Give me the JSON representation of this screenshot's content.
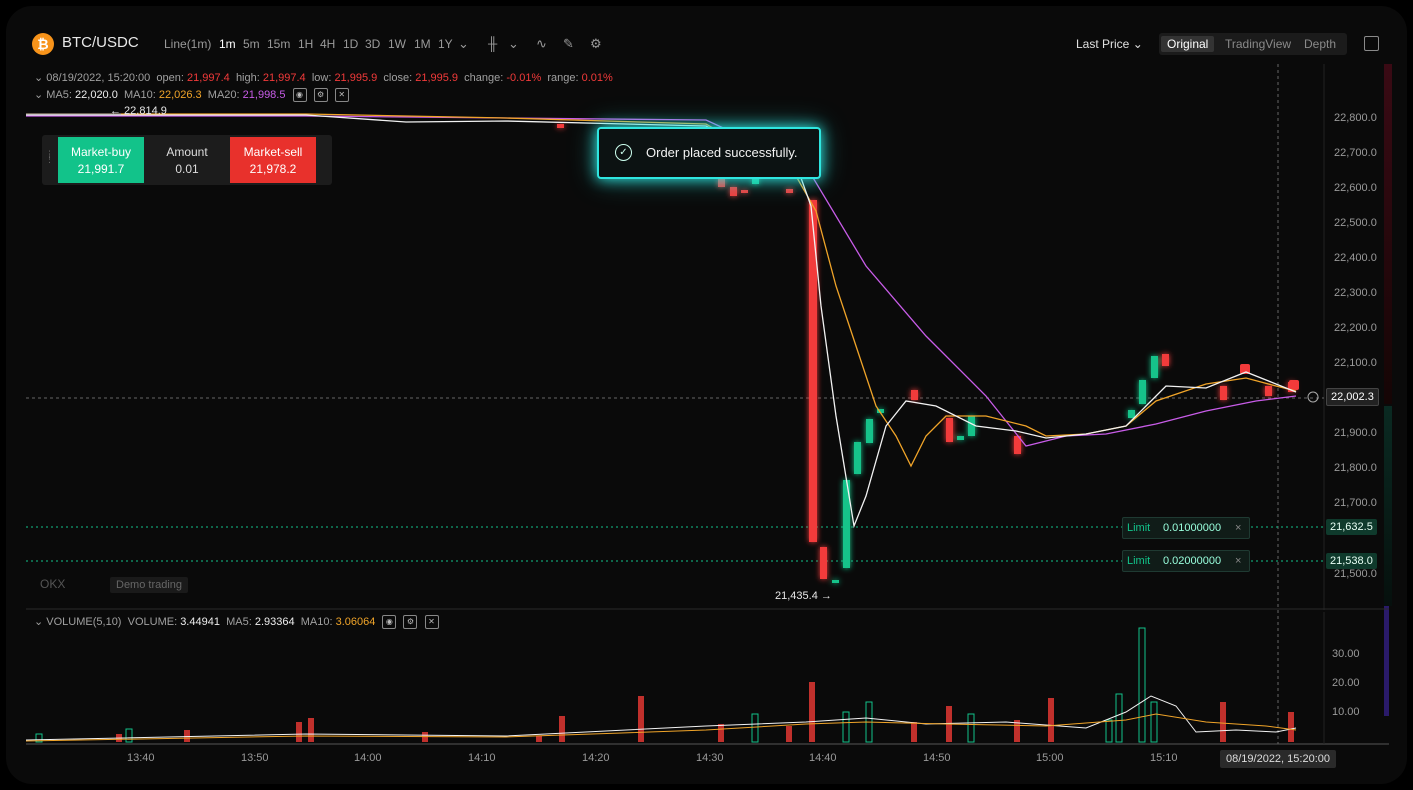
{
  "header": {
    "pair": "BTC/USDC",
    "coin_symbol": "₿",
    "chart_type": "Line(1m)",
    "timeframes": [
      "1m",
      "5m",
      "15m",
      "1H",
      "4H",
      "1D",
      "3D",
      "1W",
      "1M",
      "1Y"
    ],
    "active_timeframe": "1m",
    "last_price_label": "Last Price",
    "views": [
      "Original",
      "TradingView",
      "Depth"
    ],
    "active_view": "Original"
  },
  "ohlc": {
    "date": "08/19/2022, 15:20:00",
    "open_label": "open:",
    "open": "21,997.4",
    "high_label": "high:",
    "high": "21,997.4",
    "low_label": "low:",
    "low": "21,995.9",
    "close_label": "close:",
    "close": "21,995.9",
    "change_label": "change:",
    "change": "-0.01%",
    "range_label": "range:",
    "range": "0.01%"
  },
  "ma": {
    "ma5_label": "MA5:",
    "ma5": "22,020.0",
    "ma10_label": "MA10:",
    "ma10": "22,026.3",
    "ma20_label": "MA20:",
    "ma20": "21,998.5"
  },
  "trade_panel": {
    "buy_label": "Market-buy",
    "buy_price": "21,991.7",
    "amount_label": "Amount",
    "amount": "0.01",
    "sell_label": "Market-sell",
    "sell_price": "21,978.2"
  },
  "toast": {
    "message": "Order placed successfully."
  },
  "price_axis": [
    "22,800.0",
    "22,700.0",
    "22,600.0",
    "22,500.0",
    "22,400.0",
    "22,300.0",
    "22,200.0",
    "22,100.0",
    "21,900.0",
    "21,800.0",
    "21,700.0",
    "21,500.0"
  ],
  "current_price": "22,002.3",
  "high_marker": "← 22,814.9",
  "low_marker": "21,435.4 →",
  "limit_orders": [
    {
      "label": "Limit",
      "qty": "0.01000000",
      "price": "21,632.5"
    },
    {
      "label": "Limit",
      "qty": "0.02000000",
      "price": "21,538.0"
    }
  ],
  "watermark": {
    "brand": "OKX",
    "mode": "Demo trading"
  },
  "volume": {
    "label": "VOLUME(5,10)",
    "vol_label": "VOLUME:",
    "vol": "3.44941",
    "ma5_label": "MA5:",
    "ma5": "2.93364",
    "ma10_label": "MA10:",
    "ma10": "3.06064",
    "axis": [
      "30.00",
      "20.00",
      "10.00"
    ]
  },
  "time_axis": [
    "13:40",
    "13:50",
    "14:00",
    "14:10",
    "14:20",
    "14:30",
    "14:40",
    "14:50",
    "15:00",
    "15:10"
  ],
  "crosshair_time": "08/19/2022, 15:20:00",
  "colors": {
    "up": "#12c38a",
    "down": "#f23a3a",
    "ma5": "#ffffff",
    "ma10": "#f0a429",
    "ma20": "#c85ce8",
    "toast_glow": "#2fe6e0"
  },
  "icons": [
    "bitcoin-icon",
    "candle-type-icon",
    "indicator-icon",
    "draw-icon",
    "settings-icon",
    "fullscreen-icon",
    "eye-icon",
    "gear-icon",
    "close-icon",
    "check-circle-icon"
  ]
}
